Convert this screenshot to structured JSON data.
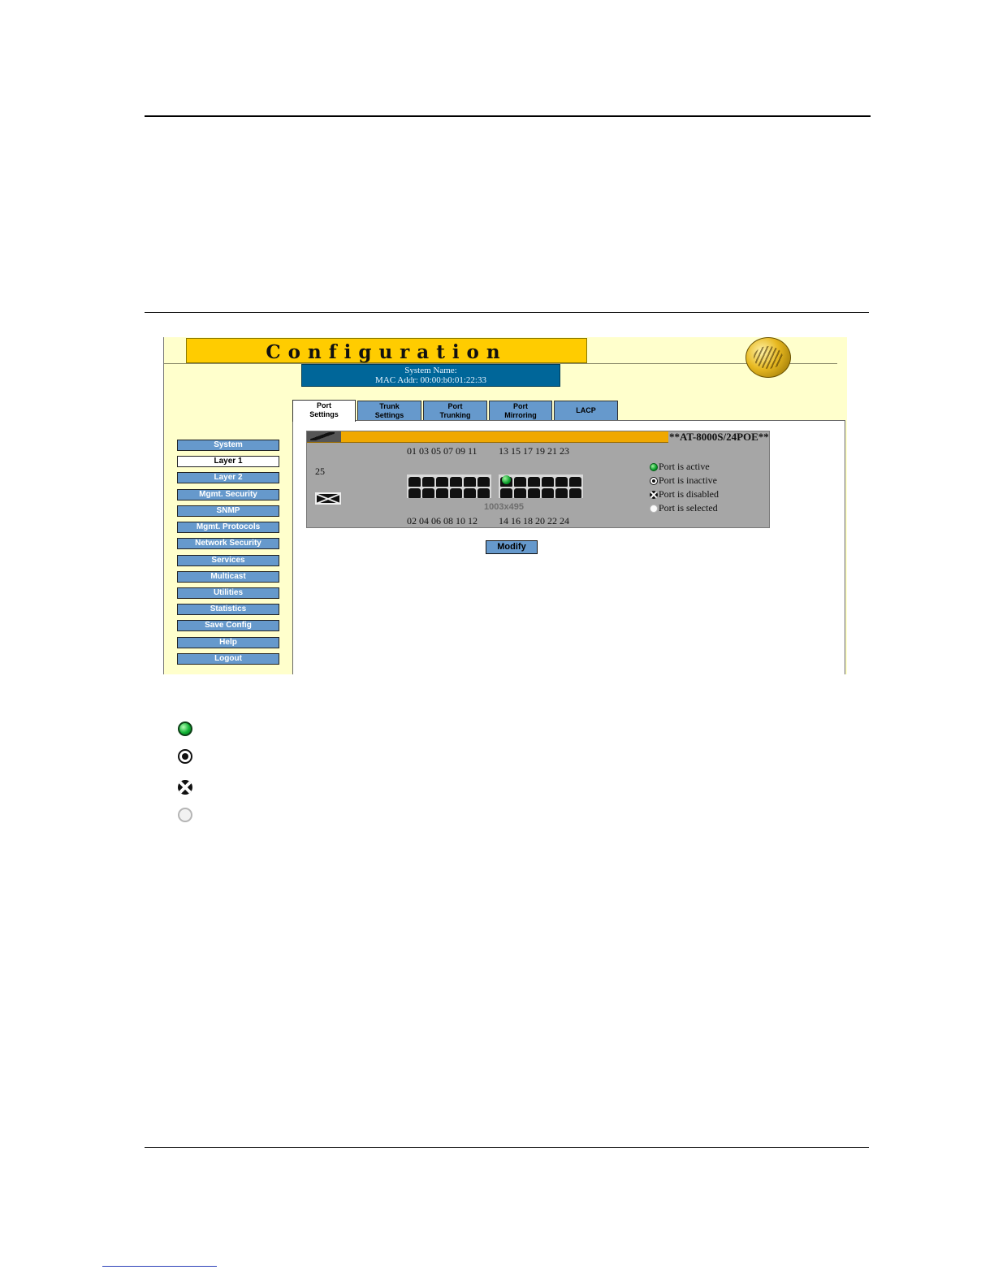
{
  "banner": {
    "title": "Configuration"
  },
  "system_info": {
    "system_name": "System Name:",
    "mac_addr": "MAC Addr:  00:00:b0:01:22:33"
  },
  "tabs": [
    {
      "label_line1": "Port",
      "label_line2": "Settings",
      "active": true
    },
    {
      "label_line1": "Trunk",
      "label_line2": "Settings",
      "active": false
    },
    {
      "label_line1": "Port",
      "label_line2": "Trunking",
      "active": false
    },
    {
      "label_line1": "Port",
      "label_line2": "Mirroring",
      "active": false
    },
    {
      "label_line1": "LACP",
      "label_line2": "",
      "active": false
    }
  ],
  "nav": [
    {
      "label": "System",
      "active": false
    },
    {
      "label": "Layer 1",
      "active": true
    },
    {
      "label": "Layer 2",
      "active": false
    },
    {
      "label": "Mgmt. Security",
      "active": false
    },
    {
      "label": "SNMP",
      "active": false
    },
    {
      "label": "Mgmt. Protocols",
      "active": false
    },
    {
      "label": "Network Security",
      "active": false
    },
    {
      "label": "Services",
      "active": false
    },
    {
      "label": "Multicast",
      "active": false
    },
    {
      "label": "Utilities",
      "active": false
    },
    {
      "label": "Statistics",
      "active": false
    },
    {
      "label": "Save Config",
      "active": false
    },
    {
      "label": "Help",
      "active": false
    },
    {
      "label": "Logout",
      "active": false
    }
  ],
  "switch_panel": {
    "model": "**AT-8000S/24POE**",
    "top_ports_left": "01 03 05 07 09 11",
    "top_ports_right": "13 15 17 19 21 23",
    "bottom_ports_left": "02 04 06 08 10 12",
    "bottom_ports_right": "14 16 18 20 22 24",
    "uplink_port": "25",
    "image_dims": "1003x495",
    "active_port": "13"
  },
  "legend": {
    "active": "Port is active",
    "inactive": "Port is inactive",
    "disabled": "Port is disabled",
    "selected": "Port is selected"
  },
  "buttons": {
    "modify": "Modify"
  },
  "colors": {
    "banner": "#ffcc00",
    "sysinfo": "#006699",
    "button": "#6699cc",
    "background": "#ffffcc",
    "port_active": "#0a9d2a"
  }
}
